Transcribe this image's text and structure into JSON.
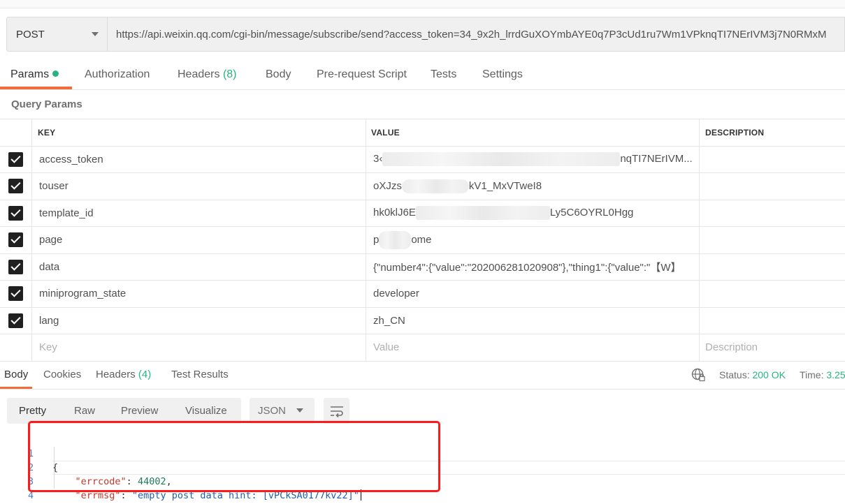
{
  "request": {
    "method": "POST",
    "url": "https://api.weixin.qq.com/cgi-bin/message/subscribe/send?access_token=34_9x2h_lrrdGuXOYmbAYE0q7P3cUd1ru7Wm1VPknqTI7NErIVM3j7N0RMxM"
  },
  "request_tabs": {
    "params": "Params",
    "authorization": "Authorization",
    "headers": "Headers",
    "headers_count": "(8)",
    "body": "Body",
    "prerequest": "Pre-request Script",
    "tests": "Tests",
    "settings": "Settings"
  },
  "query_params": {
    "label": "Query Params",
    "headers": {
      "key": "KEY",
      "value": "VALUE",
      "description": "DESCRIPTION"
    },
    "rows": [
      {
        "key": "access_token",
        "value_prefix": "3‹",
        "value_suffix": "nqTI7NErIVM..."
      },
      {
        "key": "touser",
        "value_prefix": "oXJzs",
        "value_suffix": "kV1_MxVTweI8"
      },
      {
        "key": "template_id",
        "value_prefix": "hk0klJ6E",
        "value_suffix": "Ly5C6OYRL0Hgg"
      },
      {
        "key": "page",
        "value_prefix": "p",
        "value_suffix": "ome"
      },
      {
        "key": "data",
        "value_prefix": "{\"number4\":{\"value\":\"202006281020908\"},\"thing1\":{\"value\":\"【W】",
        "value_suffix": ""
      },
      {
        "key": "miniprogram_state",
        "value_prefix": "developer",
        "value_suffix": ""
      },
      {
        "key": "lang",
        "value_prefix": "zh_CN",
        "value_suffix": ""
      }
    ],
    "placeholders": {
      "key": "Key",
      "value": "Value",
      "description": "Description"
    }
  },
  "response_tabs": {
    "body": "Body",
    "cookies": "Cookies",
    "headers": "Headers",
    "headers_count": "(4)",
    "test_results": "Test Results"
  },
  "status": {
    "label": "Status:",
    "value": "200 OK",
    "time_label": "Time:",
    "time_value": "3.25"
  },
  "view_modes": {
    "pretty": "Pretty",
    "raw": "Raw",
    "preview": "Preview",
    "visualize": "Visualize"
  },
  "format": "JSON",
  "response_body": {
    "line_numbers": [
      "1",
      "2",
      "3",
      "4"
    ],
    "open_brace": "{",
    "close_brace": "}",
    "errcode_key": "\"errcode\"",
    "errcode_value": "44002",
    "errmsg_key": "\"errmsg\"",
    "errmsg_value": "\"empty post data hint: [vPCkSA0177kv22]\""
  },
  "colors": {
    "accent": "#f26b3a",
    "success": "#26b47f",
    "highlight_box": "#ff1a1a"
  }
}
